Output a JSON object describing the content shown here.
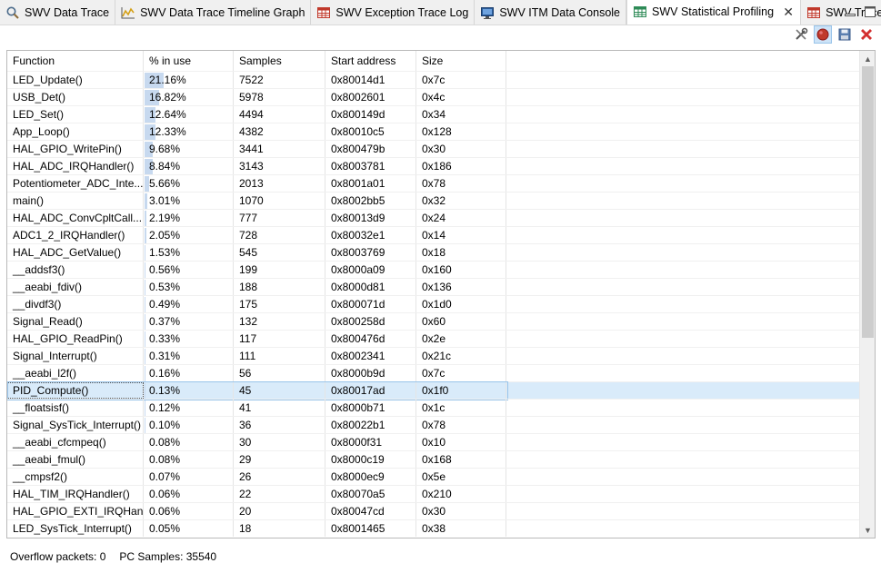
{
  "tabs": [
    {
      "label": "SWV Data Trace",
      "icon": "search-icon",
      "active": false
    },
    {
      "label": "SWV Data Trace Timeline Graph",
      "icon": "line-graph-icon",
      "active": false
    },
    {
      "label": "SWV Exception Trace Log",
      "icon": "table-red-icon",
      "active": false
    },
    {
      "label": "SWV ITM Data Console",
      "icon": "monitor-icon",
      "active": false
    },
    {
      "label": "SWV Statistical Profiling",
      "icon": "table-green-icon",
      "active": true
    },
    {
      "label": "SWV Trace Log",
      "icon": "table-red-icon",
      "active": false
    }
  ],
  "toolbar": {
    "configure": "settings-tools-icon",
    "record": "record-icon",
    "save": "save-icon",
    "clear": "clear-icon"
  },
  "table": {
    "headers": [
      "Function",
      "% in use",
      "Samples",
      "Start address",
      "Size"
    ],
    "selected_index": 18,
    "rows": [
      {
        "fn": "LED_Update()",
        "pct": "21.16%",
        "pv": 21.16,
        "samples": "7522",
        "addr": "0x80014d1",
        "size": "0x7c"
      },
      {
        "fn": "USB_Det()",
        "pct": "16.82%",
        "pv": 16.82,
        "samples": "5978",
        "addr": "0x8002601",
        "size": "0x4c"
      },
      {
        "fn": "LED_Set()",
        "pct": "12.64%",
        "pv": 12.64,
        "samples": "4494",
        "addr": "0x800149d",
        "size": "0x34"
      },
      {
        "fn": "App_Loop()",
        "pct": "12.33%",
        "pv": 12.33,
        "samples": "4382",
        "addr": "0x80010c5",
        "size": "0x128"
      },
      {
        "fn": "HAL_GPIO_WritePin()",
        "pct": "9.68%",
        "pv": 9.68,
        "samples": "3441",
        "addr": "0x800479b",
        "size": "0x30"
      },
      {
        "fn": "HAL_ADC_IRQHandler()",
        "pct": "8.84%",
        "pv": 8.84,
        "samples": "3143",
        "addr": "0x8003781",
        "size": "0x186"
      },
      {
        "fn": "Potentiometer_ADC_Inte...",
        "pct": "5.66%",
        "pv": 5.66,
        "samples": "2013",
        "addr": "0x8001a01",
        "size": "0x78"
      },
      {
        "fn": "main()",
        "pct": "3.01%",
        "pv": 3.01,
        "samples": "1070",
        "addr": "0x8002bb5",
        "size": "0x32"
      },
      {
        "fn": "HAL_ADC_ConvCpltCall...",
        "pct": "2.19%",
        "pv": 2.19,
        "samples": "777",
        "addr": "0x80013d9",
        "size": "0x24"
      },
      {
        "fn": "ADC1_2_IRQHandler()",
        "pct": "2.05%",
        "pv": 2.05,
        "samples": "728",
        "addr": "0x80032e1",
        "size": "0x14"
      },
      {
        "fn": "HAL_ADC_GetValue()",
        "pct": "1.53%",
        "pv": 1.53,
        "samples": "545",
        "addr": "0x8003769",
        "size": "0x18"
      },
      {
        "fn": "__addsf3()",
        "pct": "0.56%",
        "pv": 0.56,
        "samples": "199",
        "addr": "0x8000a09",
        "size": "0x160"
      },
      {
        "fn": "__aeabi_fdiv()",
        "pct": "0.53%",
        "pv": 0.53,
        "samples": "188",
        "addr": "0x8000d81",
        "size": "0x136"
      },
      {
        "fn": "__divdf3()",
        "pct": "0.49%",
        "pv": 0.49,
        "samples": "175",
        "addr": "0x800071d",
        "size": "0x1d0"
      },
      {
        "fn": "Signal_Read()",
        "pct": "0.37%",
        "pv": 0.37,
        "samples": "132",
        "addr": "0x800258d",
        "size": "0x60"
      },
      {
        "fn": "HAL_GPIO_ReadPin()",
        "pct": "0.33%",
        "pv": 0.33,
        "samples": "117",
        "addr": "0x800476d",
        "size": "0x2e"
      },
      {
        "fn": "Signal_Interrupt()",
        "pct": "0.31%",
        "pv": 0.31,
        "samples": "111",
        "addr": "0x8002341",
        "size": "0x21c"
      },
      {
        "fn": "__aeabi_l2f()",
        "pct": "0.16%",
        "pv": 0.16,
        "samples": "56",
        "addr": "0x8000b9d",
        "size": "0x7c"
      },
      {
        "fn": "PID_Compute()",
        "pct": "0.13%",
        "pv": 0.13,
        "samples": "45",
        "addr": "0x80017ad",
        "size": "0x1f0"
      },
      {
        "fn": "__floatsisf()",
        "pct": "0.12%",
        "pv": 0.12,
        "samples": "41",
        "addr": "0x8000b71",
        "size": "0x1c"
      },
      {
        "fn": "Signal_SysTick_Interrupt()",
        "pct": "0.10%",
        "pv": 0.1,
        "samples": "36",
        "addr": "0x80022b1",
        "size": "0x78"
      },
      {
        "fn": "__aeabi_cfcmpeq()",
        "pct": "0.08%",
        "pv": 0.08,
        "samples": "30",
        "addr": "0x8000f31",
        "size": "0x10"
      },
      {
        "fn": "__aeabi_fmul()",
        "pct": "0.08%",
        "pv": 0.08,
        "samples": "29",
        "addr": "0x8000c19",
        "size": "0x168"
      },
      {
        "fn": "__cmpsf2()",
        "pct": "0.07%",
        "pv": 0.07,
        "samples": "26",
        "addr": "0x8000ec9",
        "size": "0x5e"
      },
      {
        "fn": "HAL_TIM_IRQHandler()",
        "pct": "0.06%",
        "pv": 0.06,
        "samples": "22",
        "addr": "0x80070a5",
        "size": "0x210"
      },
      {
        "fn": "HAL_GPIO_EXTI_IRQHan...",
        "pct": "0.06%",
        "pv": 0.06,
        "samples": "20",
        "addr": "0x80047cd",
        "size": "0x30"
      },
      {
        "fn": "LED_SysTick_Interrupt()",
        "pct": "0.05%",
        "pv": 0.05,
        "samples": "18",
        "addr": "0x8001465",
        "size": "0x38"
      }
    ]
  },
  "status": {
    "overflow": "Overflow packets: 0",
    "pc_samples": "PC Samples: 35540"
  },
  "colors": {
    "bar": "#c7d9ef",
    "selected_row": "#d9ebfa"
  }
}
